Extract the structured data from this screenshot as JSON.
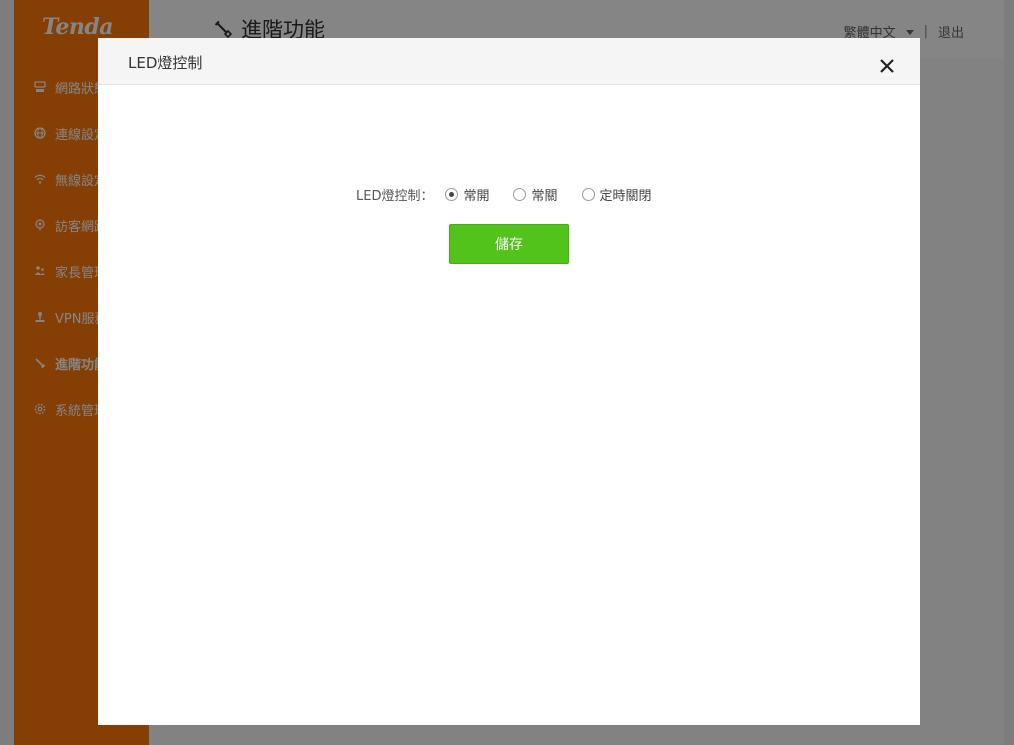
{
  "app": {
    "brand": "Tenda",
    "accent_color": "#ff7a0a",
    "language": "繁體中文",
    "logout_label": "退出",
    "separator": "|"
  },
  "page": {
    "title": "進階功能",
    "title_icon": "wrench-icon"
  },
  "sidebar": {
    "items": [
      {
        "label": "網路狀態",
        "icon": "network-status-icon",
        "active": false
      },
      {
        "label": "連線設定",
        "icon": "globe-icon",
        "active": false
      },
      {
        "label": "無線設定",
        "icon": "wifi-icon",
        "active": false
      },
      {
        "label": "訪客網路",
        "icon": "guest-network-icon",
        "active": false
      },
      {
        "label": "家長管理",
        "icon": "parental-control-icon",
        "active": false
      },
      {
        "label": "VPN服務",
        "icon": "vpn-icon",
        "active": false
      },
      {
        "label": "進階功能",
        "icon": "wrench-icon",
        "active": true
      },
      {
        "label": "系統管理",
        "icon": "gear-icon",
        "active": false
      }
    ]
  },
  "modal": {
    "title": "LED燈控制",
    "close_icon": "close-icon",
    "form": {
      "label": "LED燈控制：",
      "options": [
        {
          "label": "常開",
          "checked": true
        },
        {
          "label": "常關",
          "checked": false
        },
        {
          "label": "定時關閉",
          "checked": false
        }
      ]
    },
    "save_label": "儲存",
    "save_color": "#52c31a"
  }
}
